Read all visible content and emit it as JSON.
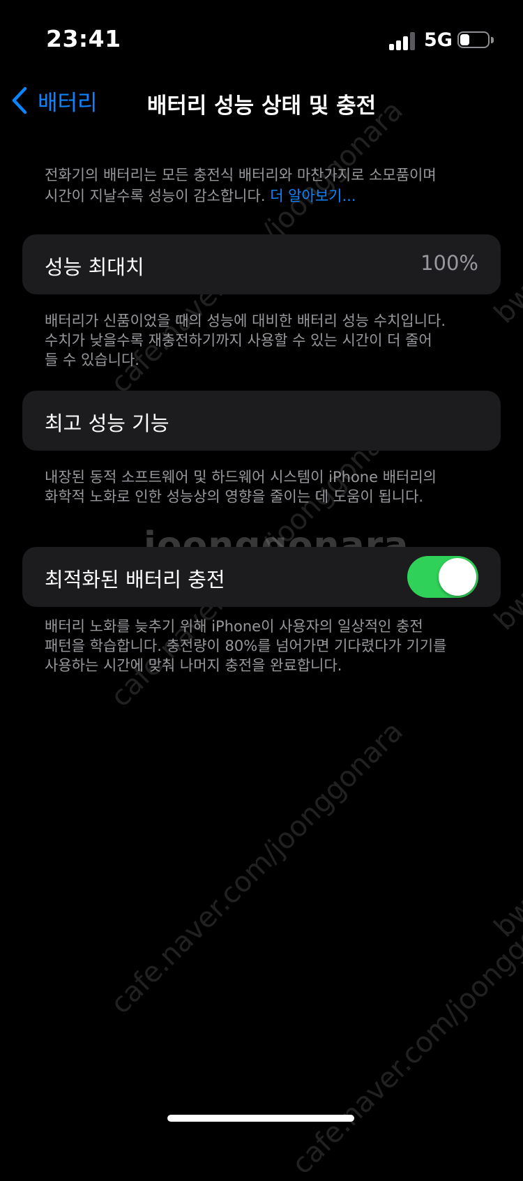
{
  "status_bar": {
    "time": "23:41",
    "network": "5G",
    "battery_level": 0.35
  },
  "nav": {
    "back_label": "배터리",
    "title": "배터리 성능 상태 및 충전"
  },
  "intro": {
    "text_line1": "전화기의 배터리는 모든 충전식 배터리와 마찬가지로 소모품이며",
    "text_line2": "시간이 지날수록 성능이 감소합니다.",
    "learn_more": "더 알아보기..."
  },
  "max_capacity": {
    "label": "성능 최대치",
    "value": "100%",
    "footnote_line1": "배터리가 신품이었을 때의 성능에 대비한 배터리 성능 수치입니다.",
    "footnote_line2": "수치가 낮을수록 재충전하기까지 사용할 수 있는 시간이 더 줄어",
    "footnote_line3": "들 수 있습니다."
  },
  "peak_performance": {
    "label": "최고 성능 기능",
    "footnote_line1": "내장된 동적 소프트웨어 및 하드웨어 시스템이 iPhone 배터리의",
    "footnote_line2": "화학적 노화로 인한 성능상의 영향을 줄이는 데 도움이 됩니다."
  },
  "optimized_charging": {
    "label": "최적화된 배터리 충전",
    "enabled": true,
    "footnote_line1": "배터리 노화를 늦추기 위해 iPhone이 사용자의 일상적인 충전",
    "footnote_line2": "패턴을 학습합니다. 충전량이 80%를 넘어가면 기다렸다가 기기를",
    "footnote_line3": "사용하는 시간에 맞춰 나머지 충전을 완료합니다."
  },
  "watermark": {
    "brand": "joonggonara",
    "url": "cafe.naver.com/joonggonara",
    "side": "bw"
  },
  "colors": {
    "background": "#000000",
    "card": "#1c1c1e",
    "accent_blue": "#0a84ff",
    "toggle_on": "#30d158",
    "secondary_text": "#98989d"
  }
}
